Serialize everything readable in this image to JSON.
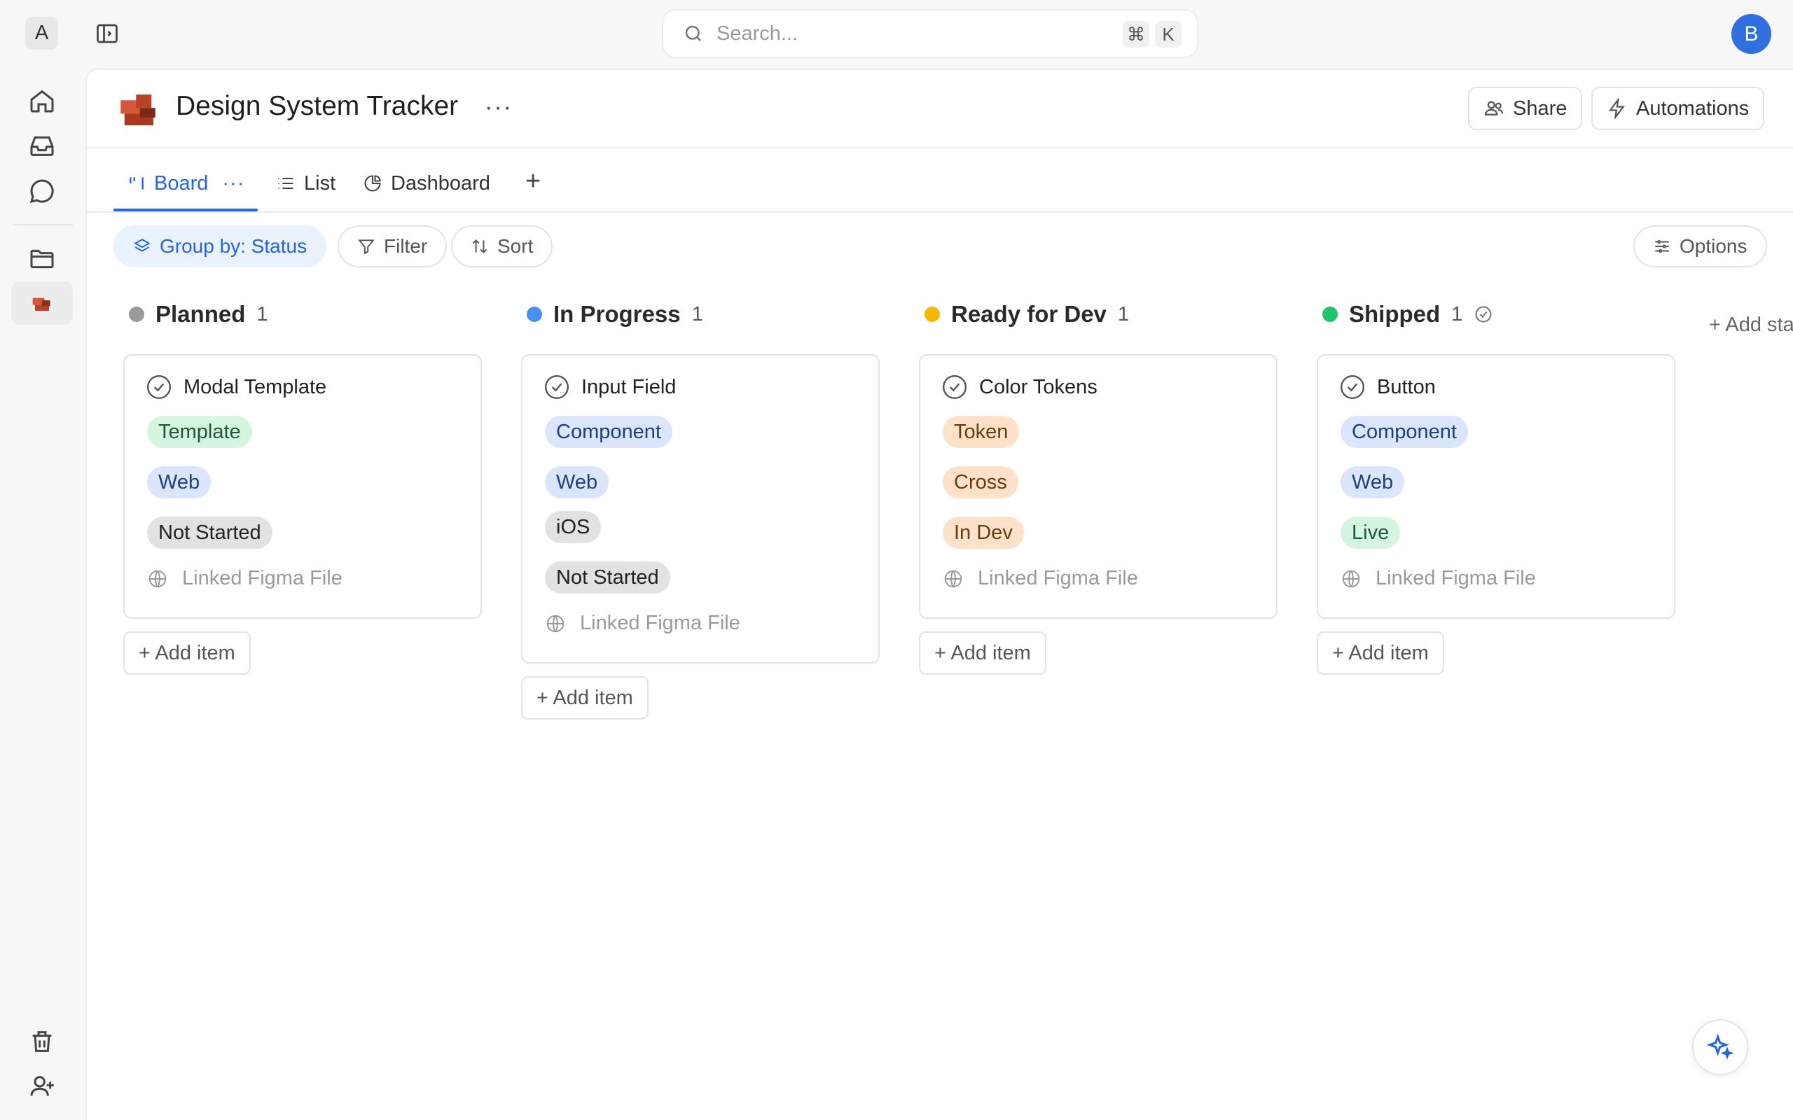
{
  "workspace": {
    "badge": "A"
  },
  "search": {
    "placeholder": "Search...",
    "shortcut_mod": "⌘",
    "shortcut_key": "K"
  },
  "user": {
    "avatar_initial": "B"
  },
  "page": {
    "title": "Design System Tracker",
    "more": "···",
    "share_label": "Share",
    "automations_label": "Automations"
  },
  "tabs": [
    {
      "label": "Board",
      "more": "···"
    },
    {
      "label": "List"
    },
    {
      "label": "Dashboard"
    }
  ],
  "toolbar": {
    "group_by": "Group by: Status",
    "filter": "Filter",
    "sort": "Sort",
    "options": "Options"
  },
  "board": {
    "add_status": "+ Add sta",
    "add_item": "+ Add item",
    "columns": [
      {
        "name": "Planned",
        "count": "1",
        "color": "#9a9a9a",
        "card": {
          "title": "Modal Template",
          "tags": [
            "Template",
            "Web",
            "Not Started"
          ],
          "link": "Linked Figma File"
        }
      },
      {
        "name": "In Progress",
        "count": "1",
        "color": "#4a90f0",
        "card": {
          "title": "Input Field",
          "tags": [
            "Component",
            "Web",
            "iOS",
            "Not Started"
          ],
          "link": "Linked Figma File"
        }
      },
      {
        "name": "Ready for Dev",
        "count": "1",
        "color": "#f5b800",
        "card": {
          "title": "Color Tokens",
          "tags": [
            "Token",
            "Cross",
            "In Dev"
          ],
          "link": "Linked Figma File"
        }
      },
      {
        "name": "Shipped",
        "count": "1",
        "color": "#1ec46a",
        "card": {
          "title": "Button",
          "tags": [
            "Component",
            "Web",
            "Live"
          ],
          "link": "Linked Figma File"
        }
      }
    ]
  }
}
